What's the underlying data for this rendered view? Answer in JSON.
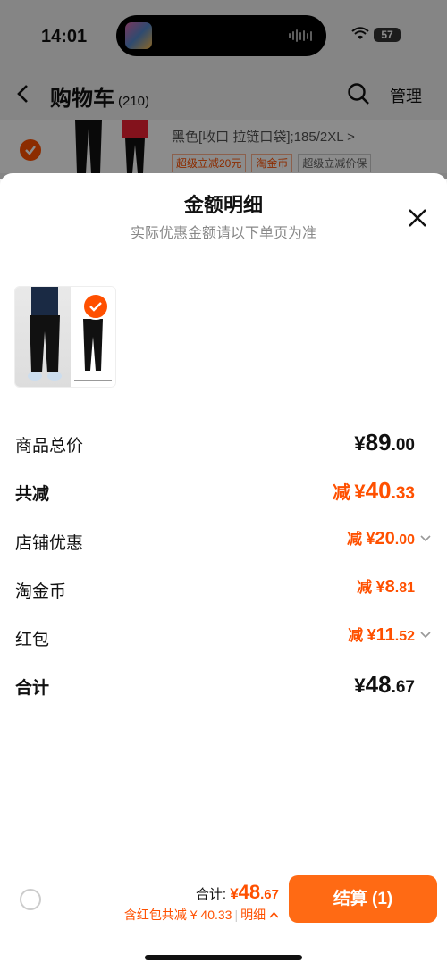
{
  "status": {
    "time": "14:01",
    "battery": "57"
  },
  "header": {
    "title": "购物车",
    "count": "(210)",
    "manage": "管理"
  },
  "bg_item": {
    "spec": "黑色[收口 拉链口袋];185/2XL >",
    "tags": [
      "超级立减20元",
      "淘金币",
      "超级立减价保"
    ]
  },
  "sheet": {
    "title": "金额明细",
    "subtitle": "实际优惠金额请以下单页为准",
    "rows": [
      {
        "label": "商品总价",
        "prefix": "",
        "yen": "¥",
        "int": "89",
        "dec": ".00"
      },
      {
        "label": "共减",
        "prefix": "减",
        "yen": "¥",
        "int": "40",
        "dec": ".33"
      },
      {
        "label": "店铺优惠",
        "prefix": "减",
        "yen": "¥",
        "int": "20",
        "dec": ".00"
      },
      {
        "label": "淘金币",
        "prefix": "减",
        "yen": "¥",
        "int": "8",
        "dec": ".81"
      },
      {
        "label": "红包",
        "prefix": "减",
        "yen": "¥",
        "int": "11",
        "dec": ".52"
      },
      {
        "label": "合计",
        "prefix": "",
        "yen": "¥",
        "int": "48",
        "dec": ".67"
      }
    ]
  },
  "bottom": {
    "total_label": "合计:",
    "total_yen": "¥",
    "total_int": "48",
    "total_dec": ".67",
    "saved_text": "含红包共减 ¥ 40.33",
    "detail_label": "明细",
    "checkout_label": "结算 (1)"
  },
  "colors": {
    "accent": "#ff5000",
    "checkout": "#ff6a14"
  }
}
